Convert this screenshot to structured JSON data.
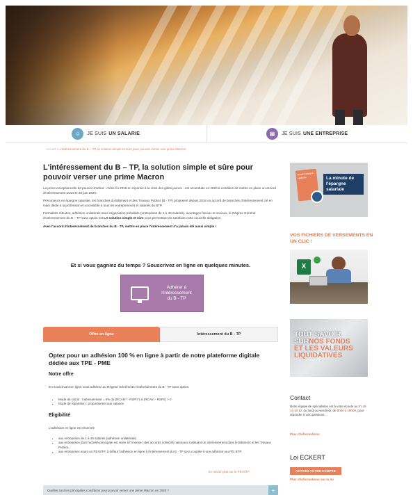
{
  "persona": {
    "employee_prefix": "JE SUIS",
    "employee_strong": "UN SALARIE",
    "company_prefix": "JE SUIS",
    "company_strong": "UNE ENTREPRISE"
  },
  "breadcrumb": {
    "home": "Accueil",
    "current": "L'intéressement du B – TP, la solution simple et sûre pour pouvoir verser une prime Macron"
  },
  "article": {
    "title": "L'intéressement du B – TP, la solution simple et sûre pour pouvoir verser une prime Macron",
    "p1": "La prime exceptionnelle de pouvoir d'achat - créée fin 2018 en réponse à la crise des gilets jaunes - est reconduite en 2020 à condition de mettre en place un accord d'intéressement avant le 30 juin 2020.",
    "p2": "Précurseurs en épargne salariale, les branches du Bâtiment et des Travaux Publics (B - TP) proposent depuis 2018 un accord de branches d'intéressement clé en main dédié à la profession et accessible à tous les entrepreneurs et salariés du BTP.",
    "p3_start": "Formalités réduites, adhésion unilatérale sans négociation préalable (entreprises de 1 à 49 salariés), avantages fiscaux et sociaux, le Régime Général d'intéressement du B – TP sans option est ",
    "p3_strong": "LA solution simple et sûre",
    "p3_end": " vous permettant de satisfaire cette nouvelle obligation.",
    "p4": "Avec l'accord d'intéressement de branches du B - TP, mettre en place l'intéressement n'a jamais été aussi simple !",
    "cta_question": "Et si vous gagniez du temps ? Souscrivez en ligne en quelques minutes.",
    "cta_button": "Adhérer à l'intéressement du B - TP"
  },
  "tabs": [
    {
      "label": "Offre en ligne",
      "active": true
    },
    {
      "label": "Intéressement du B - TP",
      "active": false
    }
  ],
  "offer": {
    "title": "Optez pour un adhésion 100 % en ligne à partir de notre plateforme digitale dédiée aux TPE - PME",
    "h_offre": "Notre offre",
    "offre_text": "En souscrivant en ligne vous adhérez au Régime Général de l'intéressement du B - TP sans option.",
    "offre_items": [
      "Mode de calcul : Intéressement = 5% du (RCAIn* - RSPn*) si (RCAIn - RSPn) > 0",
      "Mode de répartition : proportionnel aux salaires"
    ],
    "h_elig": "Eligibilité",
    "elig_text": "L'adhésion en ligne est réservée",
    "elig_items": [
      "aux entreprises de 1 à 49 salariés (adhésion unilatérale)",
      "aux entreprises dont l'activité principale est visée à l'Annexe I des accords collectifs nationaux instituant un intéressement dans le Bâtiment et les Travaux Publics,",
      "aux entreprises ayant un PEI BTP, à défaut l'adhésion en ligne à l'intéressement du B - TP sera couplée à une adhésion au PEI BTP."
    ],
    "more_pei": "En savoir plus sur le PEI BTP"
  },
  "accordion": {
    "q1": "Quelles sont les principales conditions pour pouvoir verser une prime Macron en 2020 ?",
    "plus": "+"
  },
  "sidebar": {
    "promo_title": "La minute de l'épargne salariale",
    "promo_book": "Guide Épargne salariale",
    "files_title": "VOS FICHIERS DE VERSEMENTS EN UN CLIC !",
    "funds_text_1": "TOUT SAVOIR",
    "funds_text_2": "SUR",
    "funds_text_3": "NOS FONDS",
    "funds_text_4": "ET LES VALEURS",
    "funds_text_5": "LIQUIDATIVES",
    "contact_title": "Contact",
    "contact_text_1": "Notre équipe de spécialistes est à votre écoute au ",
    "contact_phone": "01 49 14 12 12",
    "contact_text_2": ", du lundi au vendredi, de ",
    "contact_hours": "8h30 à 19h00",
    "contact_text_3": ", pour répondre à vos questions.",
    "contact_more": "Plus d'informations",
    "loi_title": "Loi ECKERT",
    "loi_button": "ACTIVEZ VOTRE COMPTE",
    "loi_more": "Plus d'informations sur la loi"
  },
  "colors": {
    "accent": "#e8805a",
    "purple": "#a87aac",
    "employee_icon": "#6aa8c8",
    "company_icon": "#8a6aa8"
  },
  "icons": {
    "employee": "people-icon",
    "company": "building-icon",
    "cta": "monitor-icon",
    "accordion": "plus-icon"
  }
}
